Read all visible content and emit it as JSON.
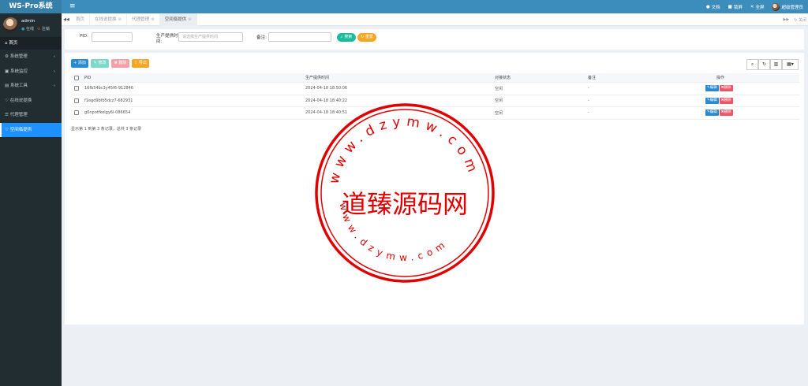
{
  "app": {
    "title": "WS-Pro系统",
    "menu_icon": "hamburger-icon"
  },
  "topbar": {
    "items": [
      {
        "icon": "info-icon",
        "label": "文档"
      },
      {
        "icon": "lock-icon",
        "label": "锁屏"
      },
      {
        "icon": "expand-icon",
        "label": "全屏"
      }
    ],
    "user": "超级管理员"
  },
  "sidebar": {
    "user": {
      "name": "admin",
      "online": "在线",
      "logout": "注销"
    },
    "header": "首页",
    "items": [
      {
        "label": "系统管理",
        "chevron": "‹"
      },
      {
        "label": "系统监控",
        "chevron": "‹"
      },
      {
        "label": "系统工具",
        "chevron": "‹"
      },
      {
        "label": "在线说提换",
        "chevron": ""
      },
      {
        "label": "代理管理",
        "chevron": ""
      },
      {
        "label": "空间临提供",
        "chevron": ""
      }
    ]
  },
  "tabs": {
    "prev": "◀◀",
    "items": [
      {
        "label": "首页",
        "close": ""
      },
      {
        "label": "在线说提换",
        "close": "⊗"
      },
      {
        "label": "代理管理",
        "close": "⊗"
      },
      {
        "label": "空间临提供",
        "close": "⊗"
      }
    ],
    "next": "▶▶",
    "action": "关闭"
  },
  "search": {
    "pid_label": "PID:",
    "time_label": "生产提供时间:",
    "time_placeholder": "请选择生产提供时间",
    "note_label": "备注:",
    "search_button": "搜索",
    "reset_button": "重置"
  },
  "toolbar": {
    "add": "+ 添加",
    "edit": "✎ 修改",
    "delete": "✖ 删除",
    "export": "⇩ 导出"
  },
  "table": {
    "headers": [
      "PID",
      "生产提供时间",
      "对接状态",
      "备注",
      "操作"
    ],
    "rows": [
      {
        "pid": "16fb54bc3y45f6-912846",
        "time": "2024-04-18 18:50:06",
        "status": "空闲",
        "note": "-"
      },
      {
        "pid": "f1egd9bfb5dcz7-682931",
        "time": "2024-04-18 18:40:22",
        "status": "空闲",
        "note": "-"
      },
      {
        "pid": "g0npotfkelgy6l-086654",
        "time": "2024-04-18 18:40:51",
        "status": "空闲",
        "note": "-"
      }
    ],
    "edit_label": "✎编辑",
    "delete_label": "✖删除",
    "summary": "显示第 1 到第 3 条记录，总共 3 条记录"
  },
  "watermark": {
    "center_text": "道臻源码网",
    "ring_text_top": "www.dzymw.com",
    "ring_text_bottom": "www.dzymw.com",
    "color": "#e00000"
  }
}
